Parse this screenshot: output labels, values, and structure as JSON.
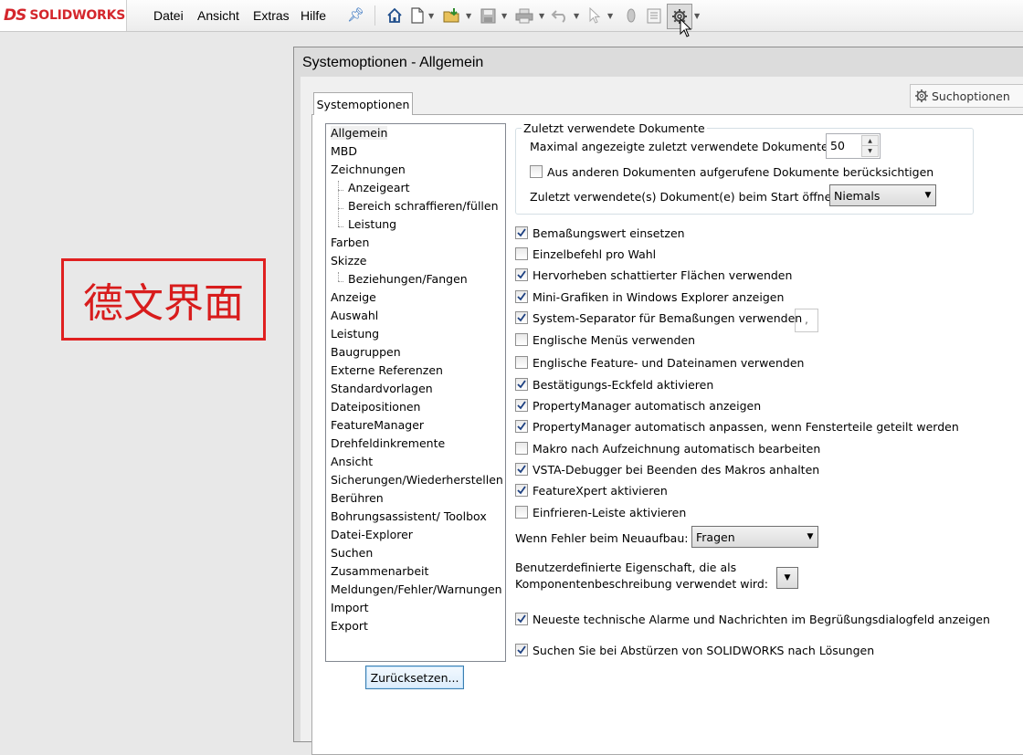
{
  "app": {
    "brand_mark": "DS",
    "brand_name": "SOLIDWORKS"
  },
  "menu": [
    "Datei",
    "Ansicht",
    "Extras",
    "Hilfe"
  ],
  "toolbar_icons": [
    "home-icon",
    "new-document-icon",
    "open-folder-icon",
    "save-icon",
    "print-icon",
    "undo-icon",
    "select-pointer-icon",
    "rebuild-icon",
    "file-properties-icon",
    "options-gear-icon"
  ],
  "overlay_label": "德文界面",
  "dialog": {
    "title": "Systemoptionen - Allgemein",
    "tab": "Systemoptionen",
    "search_placeholder": "Suchoptionen",
    "tree": [
      {
        "label": "Allgemein",
        "level": 0,
        "selected": true
      },
      {
        "label": "MBD",
        "level": 0
      },
      {
        "label": "Zeichnungen",
        "level": 0
      },
      {
        "label": "Anzeigeart",
        "level": 1
      },
      {
        "label": "Bereich schraffieren/füllen",
        "level": 1
      },
      {
        "label": "Leistung",
        "level": 1
      },
      {
        "label": "Farben",
        "level": 0
      },
      {
        "label": "Skizze",
        "level": 0
      },
      {
        "label": "Beziehungen/Fangen",
        "level": 1
      },
      {
        "label": "Anzeige",
        "level": 0
      },
      {
        "label": "Auswahl",
        "level": 0
      },
      {
        "label": "Leistung",
        "level": 0
      },
      {
        "label": "Baugruppen",
        "level": 0
      },
      {
        "label": "Externe Referenzen",
        "level": 0
      },
      {
        "label": "Standardvorlagen",
        "level": 0
      },
      {
        "label": "Dateipositionen",
        "level": 0
      },
      {
        "label": "FeatureManager",
        "level": 0
      },
      {
        "label": "Drehfeldinkremente",
        "level": 0
      },
      {
        "label": "Ansicht",
        "level": 0
      },
      {
        "label": "Sicherungen/Wiederherstellen",
        "level": 0
      },
      {
        "label": "Berühren",
        "level": 0
      },
      {
        "label": "Bohrungsassistent/ Toolbox",
        "level": 0
      },
      {
        "label": "Datei-Explorer",
        "level": 0
      },
      {
        "label": "Suchen",
        "level": 0
      },
      {
        "label": "Zusammenarbeit",
        "level": 0
      },
      {
        "label": "Meldungen/Fehler/Warnungen",
        "level": 0
      },
      {
        "label": "Import",
        "level": 0
      },
      {
        "label": "Export",
        "level": 0
      }
    ],
    "reset_button": "Zurücksetzen...",
    "recent": {
      "group_label": "Zuletzt verwendete Dokumente",
      "max_label": "Maximal angezeigte zuletzt verwendete Dokumente:",
      "max_value": "50",
      "include_other_label": "Aus anderen Dokumenten aufgerufene Dokumente berücksichtigen",
      "include_other_checked": false,
      "open_on_start_label": "Zuletzt verwendete(s) Dokument(e) beim Start öffnen:",
      "open_on_start_value": "Niemals"
    },
    "options": [
      {
        "label": "Bemaßungswert einsetzen",
        "checked": true
      },
      {
        "label": "Einzelbefehl pro Wahl",
        "checked": false
      },
      {
        "label": "Hervorheben schattierter Flächen verwenden",
        "checked": true
      },
      {
        "label": "Mini-Grafiken in Windows Explorer anzeigen",
        "checked": true
      },
      {
        "label": "System-Separator für Bemaßungen verwenden",
        "checked": true
      },
      {
        "label": "Englische Menüs verwenden",
        "checked": false
      },
      {
        "label": "Englische Feature- und Dateinamen verwenden",
        "checked": false
      },
      {
        "label": "Bestätigungs-Eckfeld aktivieren",
        "checked": true
      },
      {
        "label": "PropertyManager automatisch anzeigen",
        "checked": true
      },
      {
        "label": "PropertyManager automatisch anpassen, wenn Fensterteile geteilt werden",
        "checked": true
      },
      {
        "label": "Makro nach Aufzeichnung automatisch bearbeiten",
        "checked": false
      },
      {
        "label": "VSTA-Debugger bei Beenden des Makros anhalten",
        "checked": true
      },
      {
        "label": "FeatureXpert aktivieren",
        "checked": true
      },
      {
        "label": "Einfrieren-Leiste aktivieren",
        "checked": false
      }
    ],
    "separator_value": ",",
    "rebuild_error_label": "Wenn Fehler beim Neuaufbau:",
    "rebuild_error_value": "Fragen",
    "custom_prop_label_1": "Benutzerdefinierte Eigenschaft, die als",
    "custom_prop_label_2": "Komponentenbeschreibung verwendet wird:",
    "custom_prop_value": "",
    "bottom_options": [
      {
        "label": "Neueste technische Alarme und Nachrichten im Begrüßungsdialogfeld anzeigen",
        "checked": true
      },
      {
        "label": "Suchen Sie bei Abstürzen von SOLIDWORKS nach Lösungen",
        "checked": true
      }
    ]
  }
}
